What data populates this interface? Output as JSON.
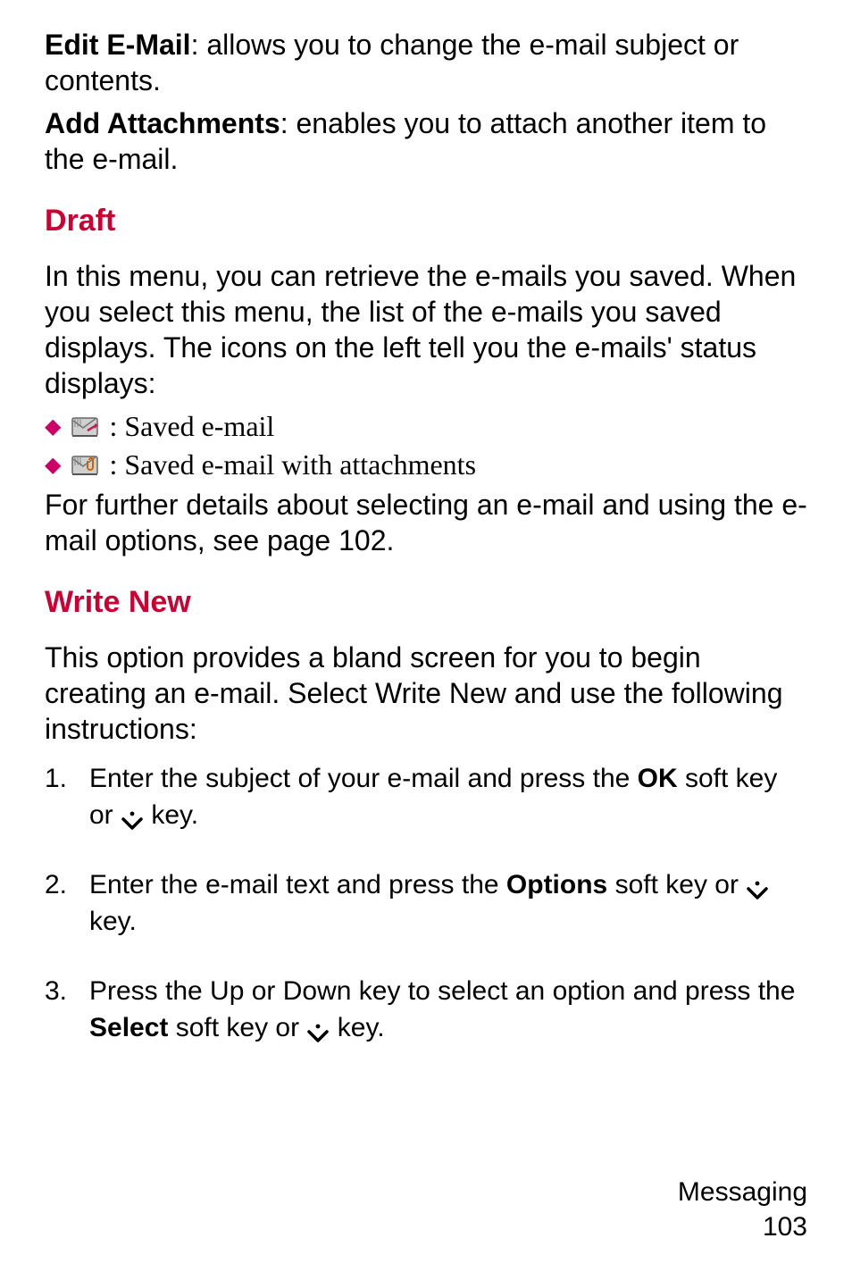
{
  "intro": {
    "edit_label": "Edit E-Mail",
    "edit_text": ": allows you to change the e-mail subject or contents.",
    "attach_label": "Add Attachments",
    "attach_text": ": enables you to attach another item to the e-mail."
  },
  "draft": {
    "heading": "Draft",
    "para": "In this menu, you can retrieve the e-mails you saved. When you select this menu, the list of the e-mails you saved displays. The icons on the left tell you the e-mails' status displays:",
    "bullet1": ": Saved e-mail",
    "bullet2": ": Saved e-mail with attachments",
    "after": "For further details about selecting an e-mail and using the e-mail options, see page 102."
  },
  "write_new": {
    "heading": "Write New",
    "para": "This option provides a bland screen for you to begin creating an e-mail.  Select Write New and use the following instructions:",
    "steps": [
      {
        "num": "1.",
        "pre": "Enter the subject of your e-mail and press the ",
        "bold": "OK",
        "mid": " soft key or ",
        "post": " key."
      },
      {
        "num": "2.",
        "pre": "Enter the e-mail text and press the ",
        "bold": "Options",
        "mid": " soft key  or ",
        "post": " key."
      },
      {
        "num": "3.",
        "pre": "Press the Up or Down key to select an option and press the ",
        "bold": "Select",
        "mid": " soft key  or ",
        "post": " key."
      }
    ]
  },
  "footer": {
    "section": "Messaging",
    "page": "103"
  }
}
